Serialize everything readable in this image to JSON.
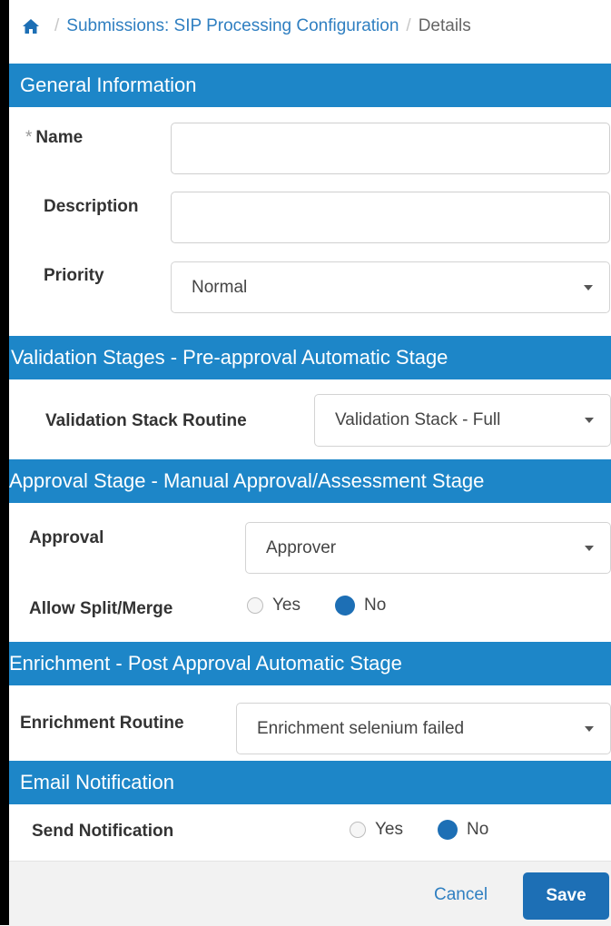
{
  "breadcrumb": {
    "home_icon": "home-icon",
    "separator": "/",
    "link": "Submissions: SIP Processing Configuration",
    "current": "Details"
  },
  "general": {
    "title": "General Information",
    "name_required_marker": "*",
    "name_label": "Name",
    "name_value": "",
    "description_label": "Description",
    "description_value": "",
    "priority_label": "Priority",
    "priority_value": "Normal"
  },
  "validation": {
    "title": "Validation Stages - Pre-approval Automatic Stage",
    "stack_label": "Validation Stack Routine",
    "stack_value": "Validation Stack - Full"
  },
  "approval": {
    "title": "Approval Stage - Manual Approval/Assessment Stage",
    "approval_label": "Approval",
    "approval_value": "Approver",
    "split_label": "Allow Split/Merge",
    "yes_label": "Yes",
    "no_label": "No",
    "split_selected": "No"
  },
  "enrichment": {
    "title": "Enrichment - Post Approval Automatic Stage",
    "routine_label": "Enrichment Routine",
    "routine_value": "Enrichment selenium failed"
  },
  "email": {
    "title": "Email Notification",
    "send_label": "Send Notification",
    "yes_label": "Yes",
    "no_label": "No",
    "send_selected": "No"
  },
  "footer": {
    "cancel_label": "Cancel",
    "save_label": "Save"
  },
  "colors": {
    "header_blue": "#1d86c8",
    "button_blue": "#1d6fb5",
    "link_blue": "#2f7fc1"
  }
}
